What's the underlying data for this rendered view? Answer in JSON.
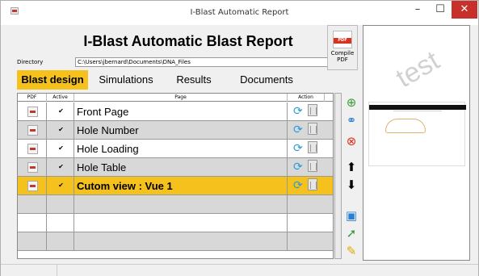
{
  "window": {
    "title": "I-Blast Automatic Report",
    "minimize": "–",
    "maximize": "☐",
    "close": "✕"
  },
  "heading": "I-Blast Automatic Blast Report",
  "directory": {
    "label": "Directory",
    "value": "C:\\Users\\jbernard\\Documents\\DNA_Files"
  },
  "compile": {
    "label": "Compile PDF"
  },
  "tabs": [
    {
      "label": "Blast design",
      "active": true
    },
    {
      "label": "Simulations",
      "active": false
    },
    {
      "label": "Results",
      "active": false
    },
    {
      "label": "Documents",
      "active": false
    }
  ],
  "grid": {
    "columns": [
      "PDF",
      "Active",
      "Page",
      "Action"
    ],
    "rows": [
      {
        "page": "Front Page",
        "active": true
      },
      {
        "page": "Hole Number",
        "active": true
      },
      {
        "page": "Hole Loading",
        "active": true
      },
      {
        "page": "Hole Table",
        "active": true
      },
      {
        "page": "Cutom view : Vue 1",
        "active": true
      }
    ]
  },
  "side_buttons": [
    "add-icon",
    "link-icon",
    "delete-icon",
    "up-arrow-icon",
    "down-arrow-icon",
    "save-icon",
    "export-icon",
    "edit-icon"
  ],
  "preview": {
    "watermark": "test"
  },
  "colors": {
    "accent": "#f5c11d",
    "close": "#c7302b"
  }
}
